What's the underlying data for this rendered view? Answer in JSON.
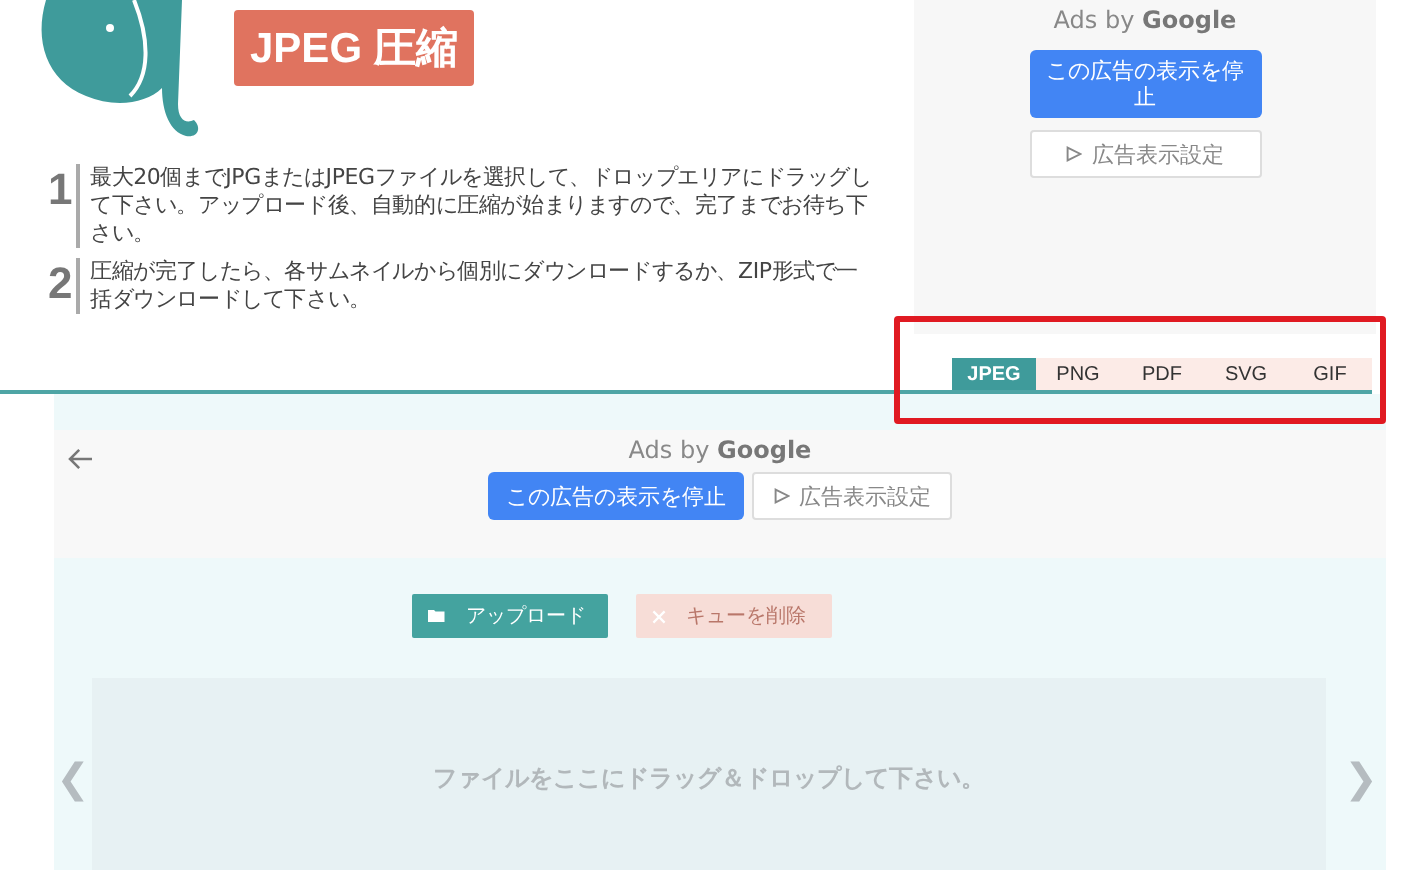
{
  "header": {
    "title": "JPEG 圧縮"
  },
  "steps": [
    {
      "number": "1",
      "text": "最大20個までJPGまたはJPEGファイルを選択して、ドロップエリアにドラッグして下さい。アップロード後、自動的に圧縮が始まりますので、完了までお待ち下さい。"
    },
    {
      "number": "2",
      "text": "圧縮が完了したら、各サムネイルから個別にダウンロードするか、ZIP形式で一括ダウンロードして下さい。"
    }
  ],
  "side_ad": {
    "ads_by": "Ads by",
    "brand": "Google",
    "stop_button": "この広告の表示を停止",
    "settings_button": "広告表示設定"
  },
  "format_tabs": [
    {
      "label": "JPEG",
      "selected": true
    },
    {
      "label": "PNG",
      "selected": false
    },
    {
      "label": "PDF",
      "selected": false
    },
    {
      "label": "SVG",
      "selected": false
    },
    {
      "label": "GIF",
      "selected": false
    }
  ],
  "tabs_highlighted": true,
  "inline_ad": {
    "ads_by": "Ads by",
    "brand": "Google",
    "stop_button": "この広告の表示を停止",
    "settings_button": "広告表示設定"
  },
  "actions": [
    {
      "label": "アップロード",
      "kind": "upload",
      "disabled": false
    },
    {
      "label": "キューを削除",
      "kind": "clear",
      "disabled": true
    }
  ],
  "dropzone": {
    "text": "ファイルをここにドラッグ＆ドロップして下さい。",
    "prev": "❮",
    "next": "❯"
  }
}
